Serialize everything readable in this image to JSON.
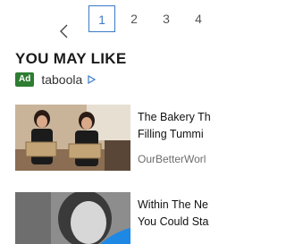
{
  "pagination": {
    "pages": [
      "1",
      "2",
      "3",
      "4"
    ],
    "active": "1"
  },
  "section": {
    "heading": "YOU MAY LIKE",
    "ad_badge": "Ad",
    "provider": "taboola"
  },
  "cards": [
    {
      "title_line1": "The Bakery Th",
      "title_line2": "Filling Tummi",
      "source": "OurBetterWorl"
    },
    {
      "title_line1": "Within The Ne",
      "title_line2": "You Could Sta"
    }
  ],
  "colors": {
    "accent": "#3a7bc8",
    "ad_badge": "#2e7d32",
    "overlay_blue": "#1e88e5"
  }
}
